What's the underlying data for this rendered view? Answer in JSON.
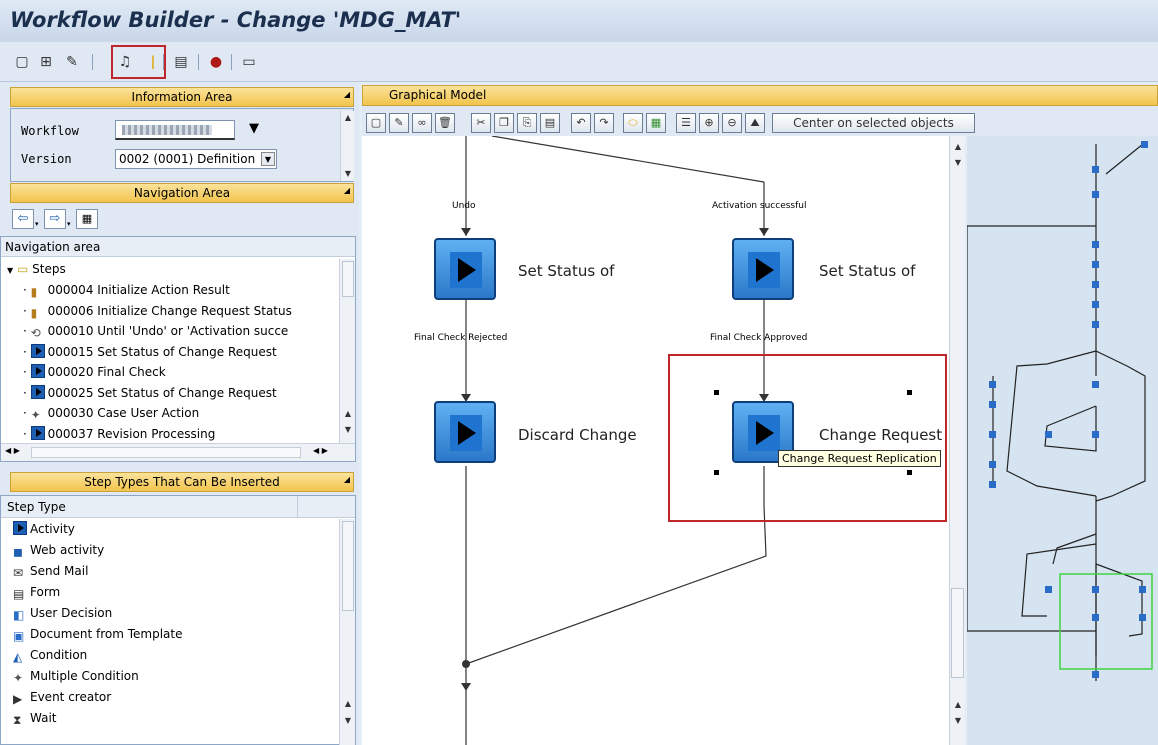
{
  "window": {
    "title": "Workflow Builder - Change 'MDG_MAT'"
  },
  "toolbar": {
    "icons": [
      "new-document-icon",
      "dependencies-icon",
      "edit-icon",
      "graphic-icon",
      "info-icon",
      "print-icon",
      "print-preview-icon",
      "layout-icon"
    ]
  },
  "info_area": {
    "title": "Information Area",
    "workflow_label": "Workflow",
    "workflow_value": "",
    "version_label": "Version",
    "version_value": "0002 (0001) Definition"
  },
  "nav_area": {
    "title": "Navigation Area",
    "subtitle": "Navigation area",
    "root": "Steps",
    "items": [
      {
        "icon": "container-op-icon",
        "label": "000004 Initialize Action Result"
      },
      {
        "icon": "container-op-icon",
        "label": "000006 Initialize Change Request Status"
      },
      {
        "icon": "loop-icon",
        "label": "000010 Until 'Undo' or 'Activation succe"
      },
      {
        "icon": "activity-icon",
        "label": "000015 Set Status of Change Request"
      },
      {
        "icon": "activity-icon",
        "label": "000020 Final Check"
      },
      {
        "icon": "activity-icon",
        "label": "000025 Set Status of Change Request"
      },
      {
        "icon": "multiple-condition-icon",
        "label": "000030 Case User Action"
      },
      {
        "icon": "activity-icon",
        "label": "000037 Revision Processing"
      }
    ]
  },
  "step_types": {
    "title": "Step Types That Can Be Inserted",
    "column": "Step Type",
    "items": [
      {
        "icon": "activity-icon",
        "label": "Activity"
      },
      {
        "icon": "web-activity-icon",
        "label": "Web activity"
      },
      {
        "icon": "send-mail-icon",
        "label": "Send Mail"
      },
      {
        "icon": "form-icon",
        "label": "Form"
      },
      {
        "icon": "user-decision-icon",
        "label": "User Decision"
      },
      {
        "icon": "document-template-icon",
        "label": "Document from Template"
      },
      {
        "icon": "condition-icon",
        "label": "Condition"
      },
      {
        "icon": "multiple-condition-icon",
        "label": "Multiple Condition"
      },
      {
        "icon": "event-creator-icon",
        "label": "Event creator"
      },
      {
        "icon": "wait-icon",
        "label": "Wait"
      }
    ]
  },
  "graphical_model": {
    "title": "Graphical Model",
    "center_button": "Center on selected objects",
    "edge_labels": {
      "undo": "Undo",
      "activation": "Activation successful",
      "rejected": "Final Check Rejected",
      "approved": "Final Check Approved"
    },
    "steps": {
      "set_status_left": "Set Status of",
      "set_status_right": "Set Status of",
      "discard": "Discard Change",
      "change_request": "Change Request"
    },
    "tooltip": "Change Request Replication"
  },
  "colors": {
    "selection_red": "#c0272d",
    "overview_green": "#3fd33f",
    "header_gold": "#f2c44d"
  }
}
